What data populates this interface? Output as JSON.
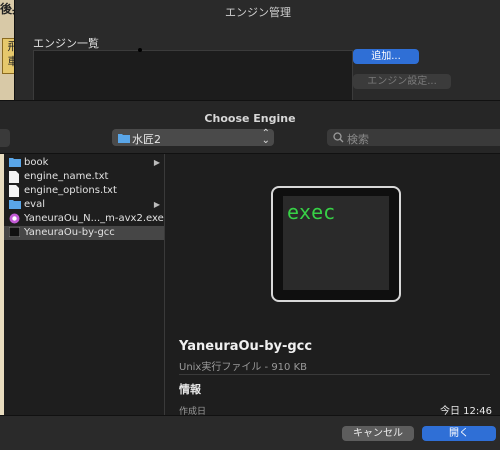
{
  "background_app": {
    "title": "後兵",
    "tile": "飛車"
  },
  "engine_manager": {
    "title": "エンジン管理",
    "list_label": "エンジン一覧",
    "add_button": "追加...",
    "settings_button": "エンジン設定..."
  },
  "dialog": {
    "title": "Choose Engine",
    "location": "水匠2",
    "search_placeholder": "検索",
    "files": [
      {
        "name": "book",
        "type": "folder",
        "has_children": true
      },
      {
        "name": "engine_name.txt",
        "type": "text"
      },
      {
        "name": "engine_options.txt",
        "type": "text"
      },
      {
        "name": "eval",
        "type": "folder",
        "has_children": true
      },
      {
        "name": "YaneuraOu_N..._m-avx2.exe",
        "type": "exe"
      },
      {
        "name": "YaneuraOu-by-gcc",
        "type": "unix-exec",
        "selected": true
      }
    ],
    "preview": {
      "icon_text": "exec",
      "name": "YaneuraOu-by-gcc",
      "kind": "Unix実行ファイル - 910 KB",
      "info_heading": "情報",
      "created_label": "作成日",
      "created_value": "今日 12:46"
    },
    "cancel_button": "キャンセル",
    "open_button": "開く"
  },
  "colors": {
    "accent": "#2f6fd6",
    "terminal_text": "#37d146"
  }
}
